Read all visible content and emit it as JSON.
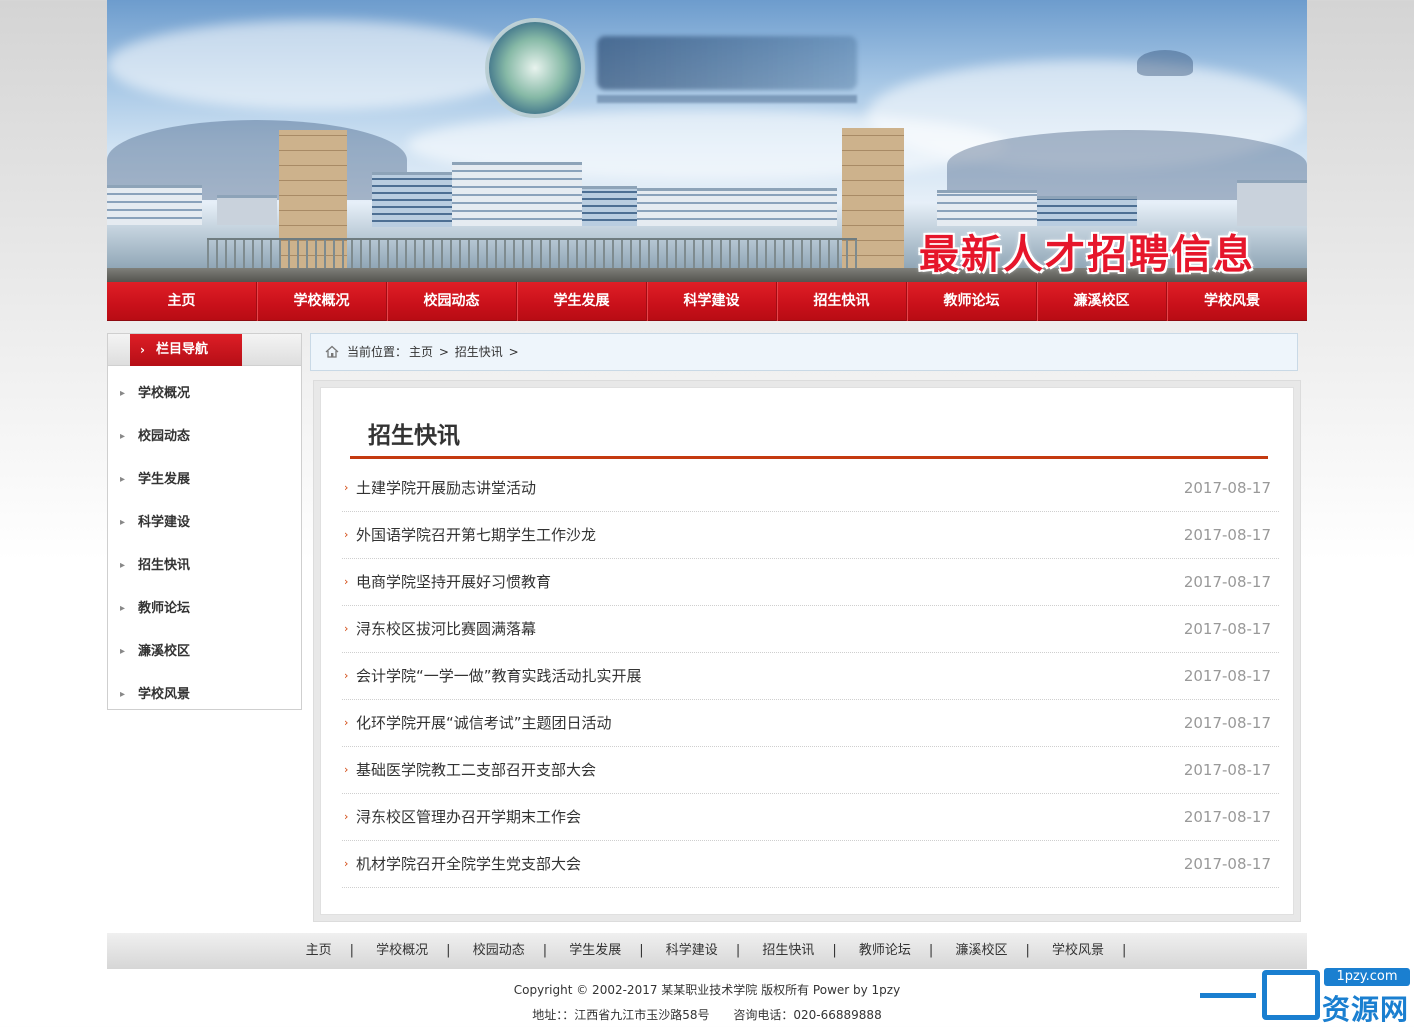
{
  "banner": {
    "slogan": "最新人才招聘信息",
    "colors": {
      "slogan": "#e6162b"
    }
  },
  "nav": {
    "items": [
      "主页",
      "学校概况",
      "校园动态",
      "学生发展",
      "科学建设",
      "招生快讯",
      "教师论坛",
      "濂溪校区",
      "学校风景"
    ],
    "color": "#c9101a"
  },
  "sidebar": {
    "title": "栏目导航",
    "items": [
      "学校概况",
      "校园动态",
      "学生发展",
      "科学建设",
      "招生快讯",
      "教师论坛",
      "濂溪校区",
      "学校风景"
    ]
  },
  "breadcrumb": {
    "label": "当前位置：",
    "items": [
      "主页",
      "招生快讯"
    ],
    "sep": ">"
  },
  "main": {
    "title": "招生快讯",
    "news": [
      {
        "title": "土建学院开展励志讲堂活动",
        "date": "2017-08-17"
      },
      {
        "title": "外国语学院召开第七期学生工作沙龙",
        "date": "2017-08-17"
      },
      {
        "title": "电商学院坚持开展好习惯教育",
        "date": "2017-08-17"
      },
      {
        "title": "浔东校区拔河比赛圆满落幕",
        "date": "2017-08-17"
      },
      {
        "title": "会计学院“一学一做”教育实践活动扎实开展",
        "date": "2017-08-17"
      },
      {
        "title": "化环学院开展“诚信考试”主题团日活动",
        "date": "2017-08-17"
      },
      {
        "title": "基础医学院教工二支部召开支部大会",
        "date": "2017-08-17"
      },
      {
        "title": "浔东校区管理办召开学期末工作会",
        "date": "2017-08-17"
      },
      {
        "title": "机材学院召开全院学生党支部大会",
        "date": "2017-08-17"
      }
    ],
    "accent": "#c43a10"
  },
  "footer": {
    "links": [
      "主页",
      "学校概况",
      "校园动态",
      "学生发展",
      "科学建设",
      "招生快讯",
      "教师论坛",
      "濂溪校区",
      "学校风景"
    ],
    "copyright": "Copyright © 2002-2017 某某职业技术学院 版权所有 Power by 1pzy",
    "address": "地址：：江西省九江市玉沙路58号",
    "phone": "咨询电话：020-66889888"
  },
  "watermark": {
    "url": "1pzy.com",
    "name": "资源网",
    "color": "#1a7fd0"
  }
}
